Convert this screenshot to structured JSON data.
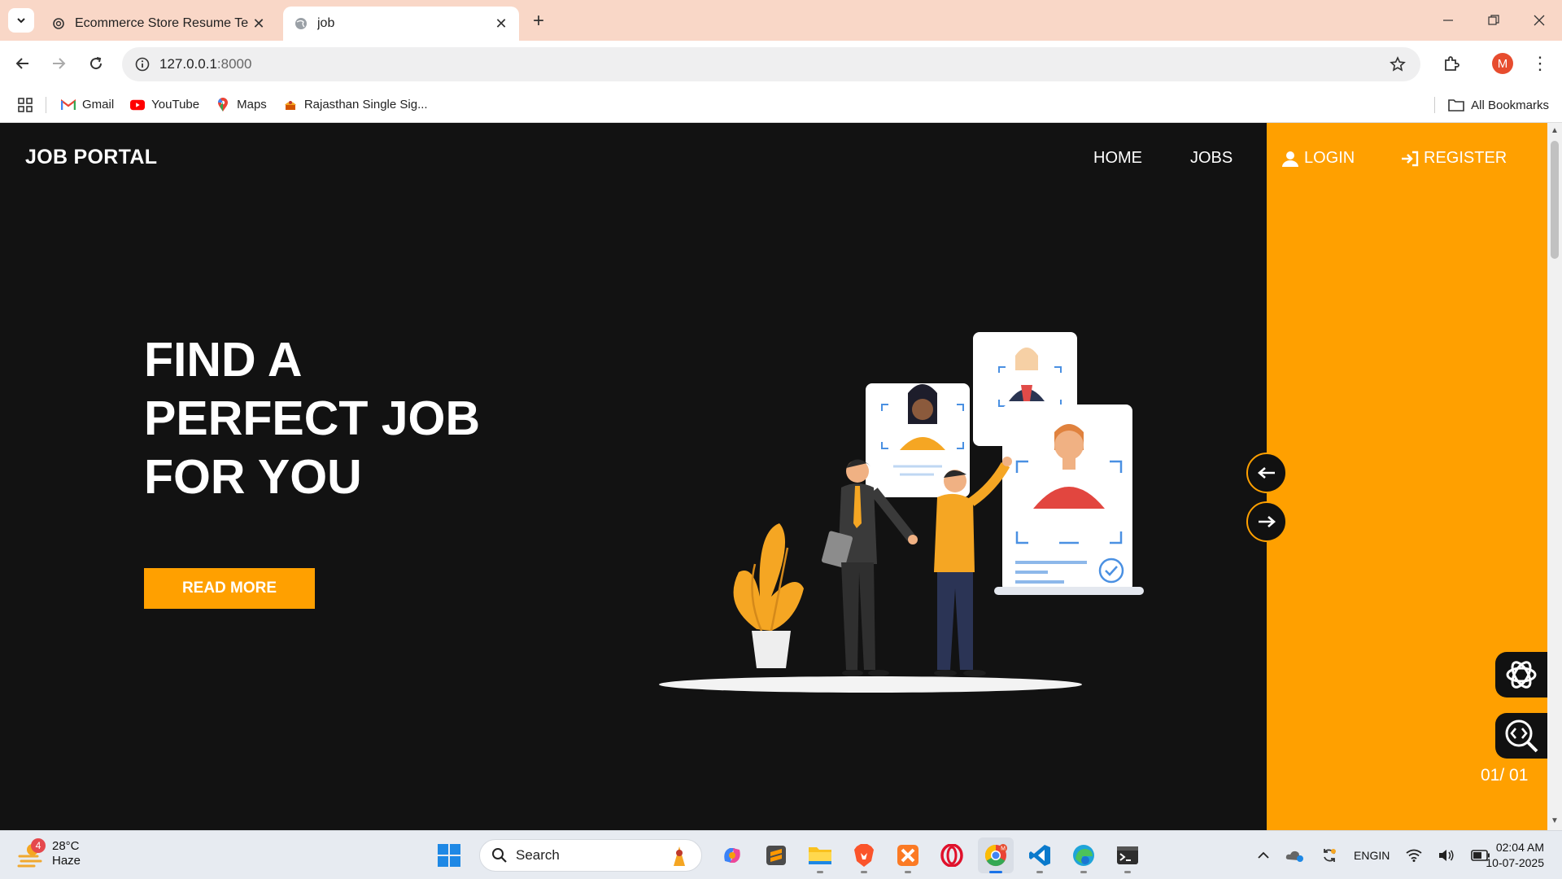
{
  "browser": {
    "tabs": [
      {
        "title": "Ecommerce Store Resume Temp",
        "active": false
      },
      {
        "title": "job",
        "active": true
      }
    ],
    "url_host": "127.0.0.1",
    "url_port": ":8000",
    "profile_initial": "M",
    "bookmarks": [
      {
        "label": "Gmail",
        "icon": "gmail-icon"
      },
      {
        "label": "YouTube",
        "icon": "youtube-icon"
      },
      {
        "label": "Maps",
        "icon": "maps-icon"
      },
      {
        "label": "Rajasthan Single Sig...",
        "icon": "rajasthan-icon"
      }
    ],
    "all_bookmarks": "All Bookmarks"
  },
  "site": {
    "brand": "JOB PORTAL",
    "nav": {
      "home": "HOME",
      "jobs": "JOBS",
      "login": "LOGIN",
      "register": "REGISTER"
    },
    "hero": {
      "line1": "FIND A",
      "line2": "PERFECT JOB",
      "line3": "FOR YOU",
      "cta": "READ MORE"
    },
    "slide_counter": "01/ 01",
    "accent_color": "#ffa000"
  },
  "taskbar": {
    "weather_badge": "4",
    "temperature": "28°C",
    "condition": "Haze",
    "search_label": "Search",
    "lang_line1": "ENG",
    "lang_line2": "IN",
    "time": "02:04 AM",
    "date": "10-07-2025"
  }
}
